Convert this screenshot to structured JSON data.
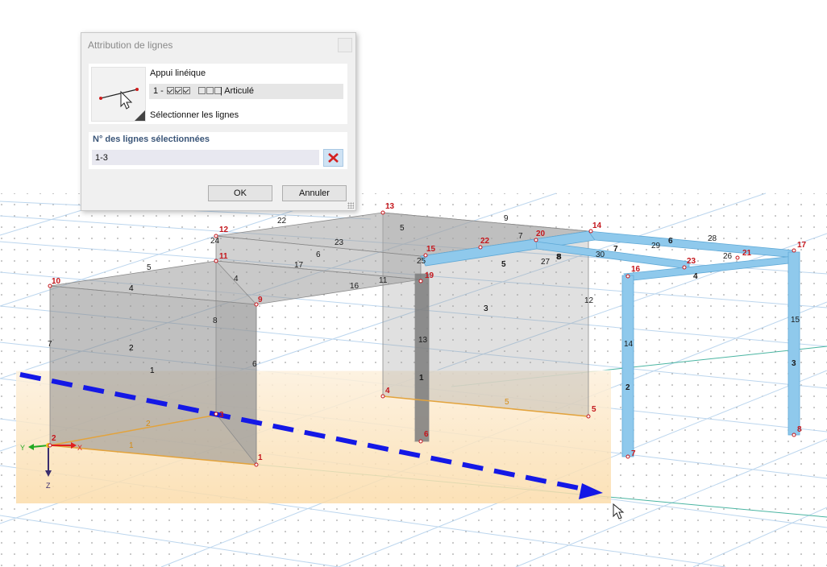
{
  "dialog": {
    "title": "Attribution de lignes",
    "support_title": "Appui linéique",
    "support_prefix": "1 -",
    "support_checks": [
      true,
      true,
      true,
      false,
      false,
      false
    ],
    "support_suffix": "| Articulé",
    "select_lines_label": "Sélectionner les lignes",
    "selected_lines_label": "N° des lignes sélectionnées",
    "selected_lines_value": "1-3",
    "ok_label": "OK",
    "cancel_label": "Annuler"
  },
  "viewport": {
    "colors": {
      "node": "#c4161c",
      "member_blue": "#8fc9ec",
      "surface_gray": "#9a9a9a",
      "selection_fill": "#fbe1b4",
      "drag_arrow": "#1418e6",
      "axis_x": "#e02020",
      "axis_y": "#22a822",
      "axis_z": "#3a2d6e"
    },
    "axis_labels": {
      "x": "X",
      "y": "Y",
      "z": "Z"
    },
    "node_numbers": [
      "1",
      "2",
      "3",
      "4",
      "5",
      "6",
      "7",
      "8",
      "9",
      "10",
      "11",
      "12",
      "13",
      "14",
      "15",
      "16",
      "17",
      "19",
      "20",
      "21",
      "22",
      "23"
    ],
    "line_numbers": [
      "1",
      "2",
      "3",
      "4",
      "5",
      "6",
      "7",
      "8",
      "9",
      "11",
      "12",
      "13",
      "14",
      "15",
      "16",
      "17",
      "22",
      "23",
      "24",
      "25",
      "26",
      "27",
      "28",
      "29",
      "30",
      "4",
      "5",
      "6",
      "7",
      "8",
      "1",
      "2",
      "3",
      "4",
      "5",
      "6",
      "7",
      "8",
      "3",
      "4",
      "1",
      "2",
      "1",
      "2",
      "3",
      "5"
    ]
  }
}
